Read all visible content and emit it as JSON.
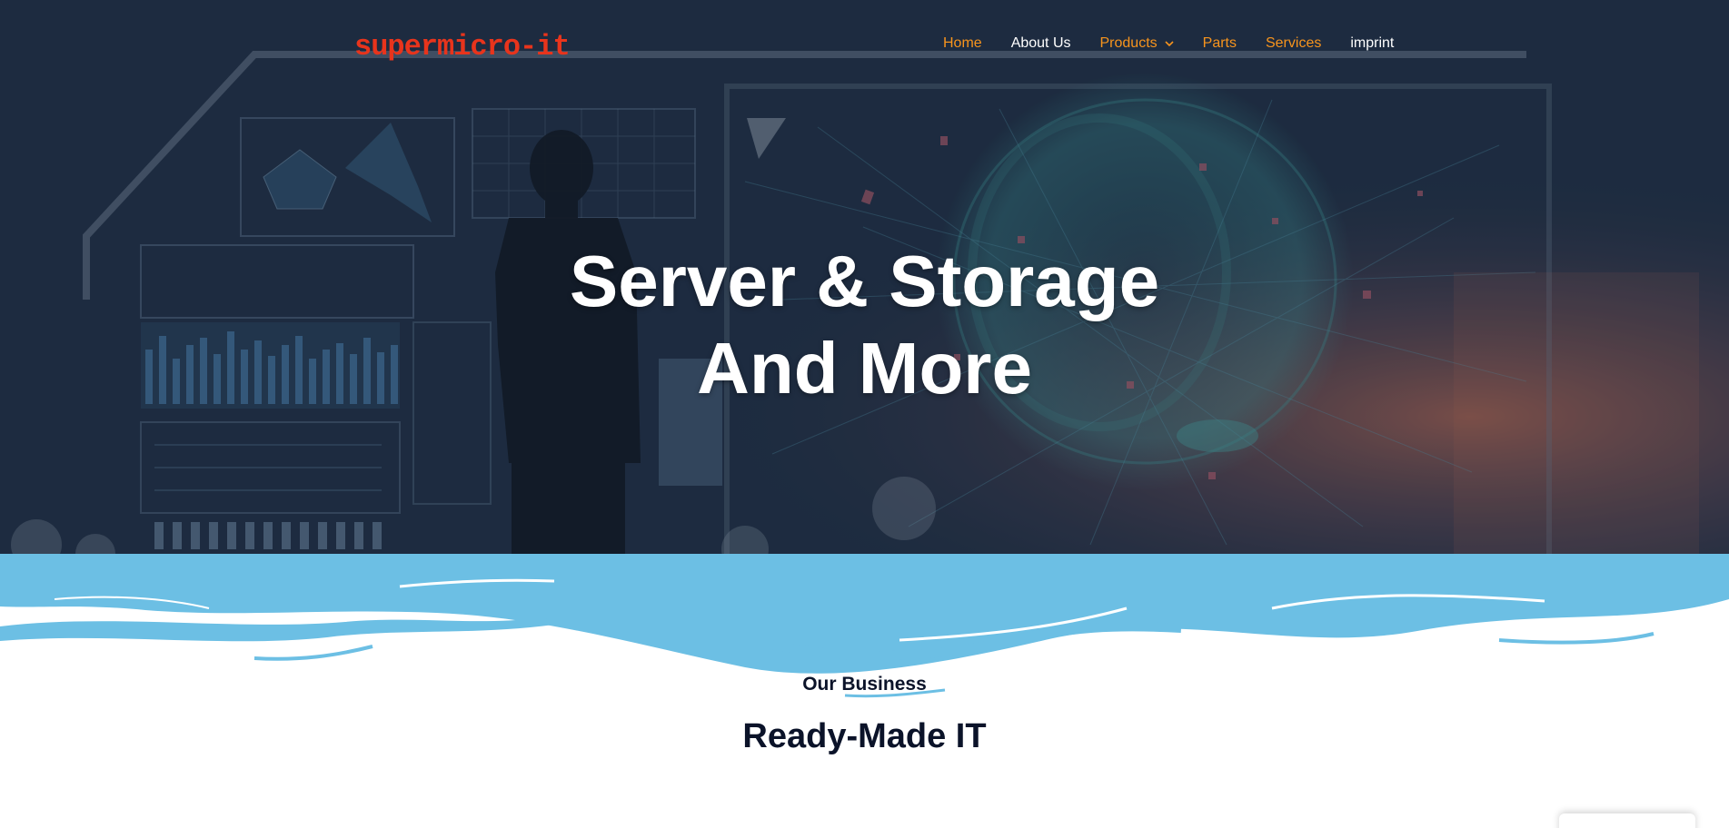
{
  "brand": {
    "logo_text": "supermicro-it",
    "logo_color": "#e8341c"
  },
  "nav": {
    "items": [
      {
        "label": "Home",
        "color": "#f7941d"
      },
      {
        "label": "About Us",
        "color": "#ffffff"
      },
      {
        "label": "Products",
        "color": "#f7941d",
        "icon": "chevron-down-icon"
      },
      {
        "label": "Parts",
        "color": "#f7941d"
      },
      {
        "label": "Services",
        "color": "#f7941d"
      },
      {
        "label": "imprint",
        "color": "#ffffff"
      }
    ]
  },
  "hero": {
    "title_line1": "Server & Storage",
    "title_line2": "And More"
  },
  "section": {
    "eyebrow": "Our Business",
    "title": "Ready-Made IT"
  },
  "colors": {
    "wave_blue": "#6cbfe4",
    "heading_navy": "#0b1329",
    "nav_accent": "#f7941d"
  }
}
